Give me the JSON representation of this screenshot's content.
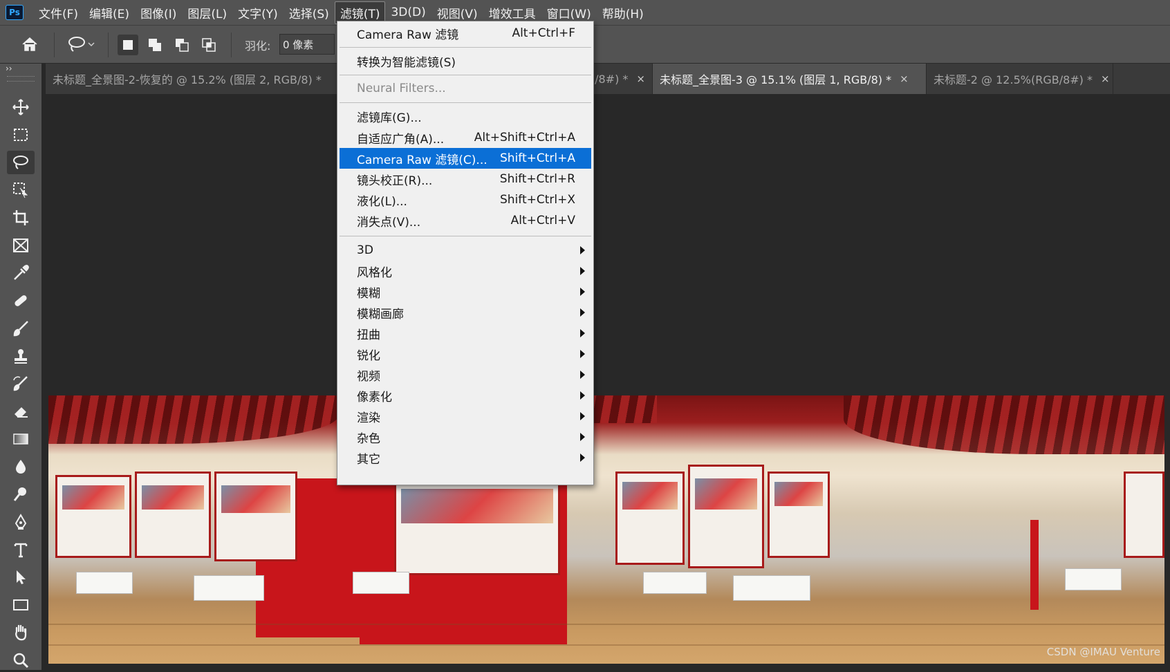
{
  "app": {
    "logo": "Ps"
  },
  "menubar": {
    "items": [
      "文件(F)",
      "编辑(E)",
      "图像(I)",
      "图层(L)",
      "文字(Y)",
      "选择(S)",
      "滤镜(T)",
      "3D(D)",
      "视图(V)",
      "增效工具",
      "窗口(W)",
      "帮助(H)"
    ],
    "active_index": 6
  },
  "options": {
    "feather_label": "羽化:",
    "feather_value": "0 像素"
  },
  "tabs": [
    {
      "title": "未标题_全景图-2-恢复的 @ 15.2% (图层 2, RGB/8) *",
      "active": false
    },
    {
      "title": "/8#) *",
      "active": false
    },
    {
      "title": "未标题_全景图-3 @ 15.1% (图层 1, RGB/8) *",
      "active": true
    },
    {
      "title": "未标题-2 @ 12.5%(RGB/8#) *",
      "active": false
    }
  ],
  "tab_close_glyph": "×",
  "toolbar": {
    "collapse_glyph": "››",
    "tools": [
      "move-tool-icon",
      "marquee-tool-icon",
      "lasso-tool-icon",
      "object-select-tool-icon",
      "crop-tool-icon",
      "frame-tool-icon",
      "eyedropper-tool-icon",
      "healing-brush-tool-icon",
      "brush-tool-icon",
      "clone-stamp-tool-icon",
      "history-brush-tool-icon",
      "eraser-tool-icon",
      "gradient-tool-icon",
      "blur-tool-icon",
      "dodge-tool-icon",
      "pen-tool-icon",
      "type-tool-icon",
      "path-select-tool-icon",
      "rectangle-tool-icon",
      "hand-tool-icon",
      "zoom-tool-icon"
    ],
    "active_tool": "lasso-tool-icon"
  },
  "filter_menu": {
    "items": [
      {
        "label": "Camera Raw 滤镜",
        "shortcut": "Alt+Ctrl+F"
      },
      {
        "label": "转换为智能滤镜(S)",
        "shortcut": ""
      },
      {
        "label": "Neural Filters...",
        "shortcut": "",
        "disabled": true
      },
      {
        "label": "滤镜库(G)...",
        "shortcut": ""
      },
      {
        "label": "自适应广角(A)...",
        "shortcut": "Alt+Shift+Ctrl+A"
      },
      {
        "label": "Camera Raw 滤镜(C)...",
        "shortcut": "Shift+Ctrl+A",
        "highlighted": true
      },
      {
        "label": "镜头校正(R)...",
        "shortcut": "Shift+Ctrl+R"
      },
      {
        "label": "液化(L)...",
        "shortcut": "Shift+Ctrl+X"
      },
      {
        "label": "消失点(V)...",
        "shortcut": "Alt+Ctrl+V"
      },
      {
        "label": "3D",
        "submenu": true
      },
      {
        "label": "风格化",
        "submenu": true
      },
      {
        "label": "模糊",
        "submenu": true
      },
      {
        "label": "模糊画廊",
        "submenu": true
      },
      {
        "label": "扭曲",
        "submenu": true
      },
      {
        "label": "锐化",
        "submenu": true
      },
      {
        "label": "视频",
        "submenu": true
      },
      {
        "label": "像素化",
        "submenu": true
      },
      {
        "label": "渲染",
        "submenu": true
      },
      {
        "label": "杂色",
        "submenu": true
      },
      {
        "label": "其它",
        "submenu": true
      }
    ]
  },
  "canvas": {
    "watermark": "CSDN @IMAU Venture"
  },
  "colors": {
    "highlight": "#0b6fd6",
    "panel": "#535353",
    "workspace": "#282828",
    "ps_blue": "#31a8ff"
  }
}
